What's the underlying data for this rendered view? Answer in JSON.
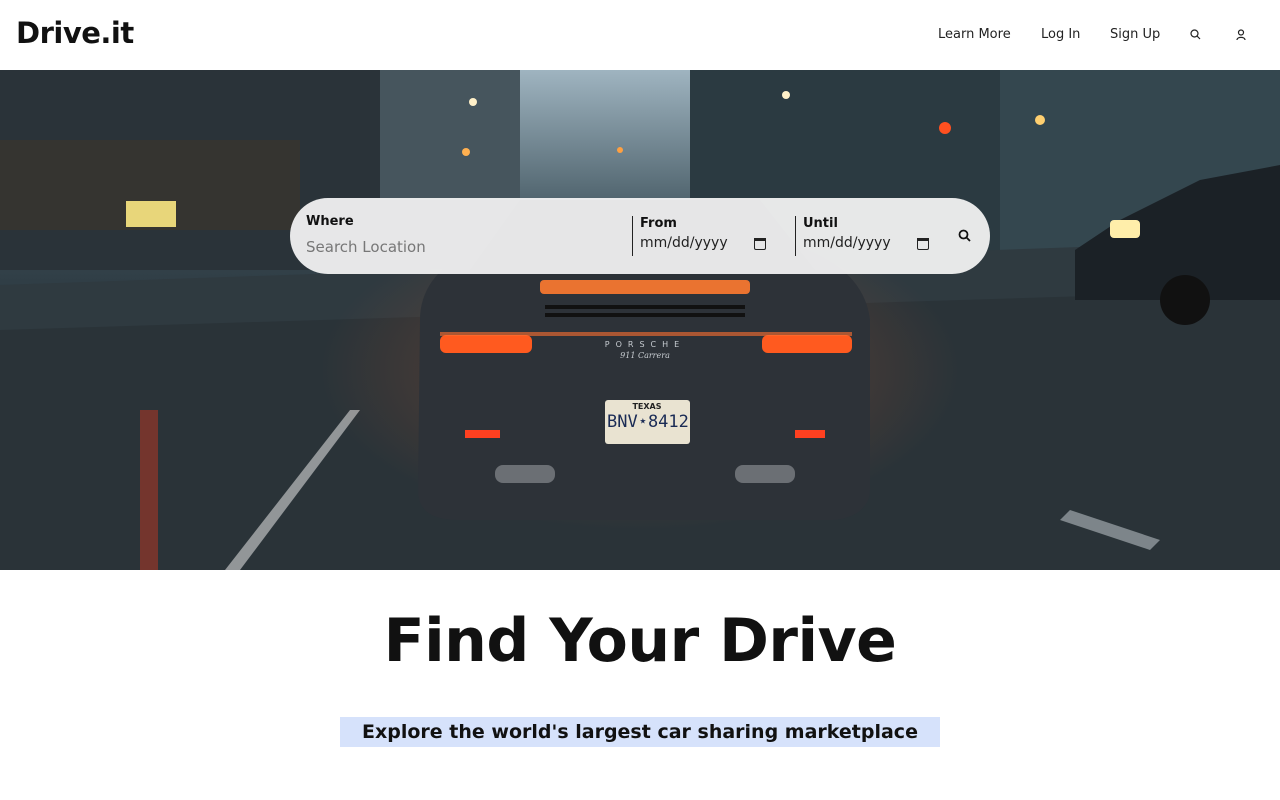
{
  "header": {
    "logo": "Drive.it",
    "nav": {
      "learn_more": "Learn More",
      "log_in": "Log In",
      "sign_up": "Sign Up"
    },
    "icons": [
      "search-icon",
      "user-icon"
    ]
  },
  "search": {
    "where_label": "Where",
    "where_placeholder": "Search Location",
    "from_label": "From",
    "from_value": "mm/dd/yyyy",
    "until_label": "Until",
    "until_value": "mm/dd/yyyy",
    "icons": [
      "calendar-icon",
      "search-icon"
    ]
  },
  "hero": {
    "plate_state": "TEXAS",
    "plate_number": "BNV⋆8412",
    "car_brand": "PORSCHE",
    "car_model": "911 Carrera"
  },
  "main": {
    "headline": "Find Your Drive",
    "tagline": "Explore the world's largest car sharing marketplace"
  },
  "colors": {
    "tagline_bg": "#d6e2fb",
    "taillight": "#ff5a1f"
  }
}
